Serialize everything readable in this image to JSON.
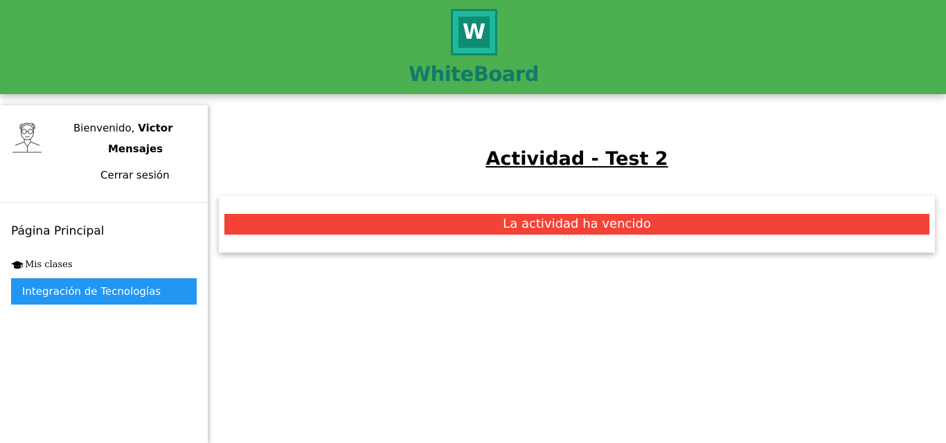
{
  "header": {
    "logo_letter": "W",
    "logo_text": "WhiteBoard"
  },
  "sidebar": {
    "welcome_prefix": "Bienvenido, ",
    "user_name": "Victor",
    "messages_label": "Mensajes",
    "logout_label": "Cerrar sesión",
    "home_label": "Página Principal",
    "classes_heading": "Mis clases",
    "classes": [
      {
        "label": "Integración de Tecnologías"
      }
    ]
  },
  "main": {
    "title": "Actividad - Test 2",
    "alert_text": "La actividad ha vencido"
  },
  "colors": {
    "header_bg": "#4caf50",
    "logo_teal": "#117a6a",
    "active_class_bg": "#2196f3",
    "alert_bg": "#f44336"
  },
  "icons": {
    "avatar": "user-sketch-avatar",
    "classes": "graduation-cap-icon"
  }
}
